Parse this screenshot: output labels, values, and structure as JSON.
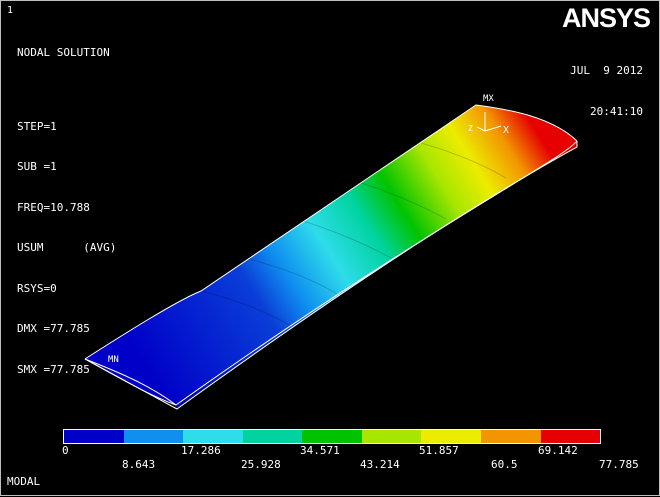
{
  "window_number": "1",
  "header": {
    "title": "NODAL SOLUTION",
    "lines": [
      "STEP=1",
      "SUB =1",
      "FREQ=10.788",
      "USUM      (AVG)",
      "RSYS=0",
      "DMX =77.785",
      "SMX =77.785"
    ]
  },
  "brand": {
    "logo": "ANSYS"
  },
  "timestamp": {
    "date": "JUL  9 2012",
    "time": "20:41:10"
  },
  "markers": {
    "max_label": "MX",
    "min_label": "MN",
    "axis_x": "X",
    "axis_z": "Z"
  },
  "legend": {
    "colors": [
      "#0000c8",
      "#0f8ff0",
      "#2fdcea",
      "#00d3a0",
      "#00c300",
      "#a8e600",
      "#ecec00",
      "#f29500",
      "#e60000"
    ],
    "top_labels": [
      "0",
      "17.286",
      "34.571",
      "51.857",
      "69.142"
    ],
    "bottom_labels": [
      "8.643",
      "25.928",
      "43.214",
      "60.5",
      "77.785"
    ]
  },
  "footer": {
    "label": "MODAL"
  }
}
